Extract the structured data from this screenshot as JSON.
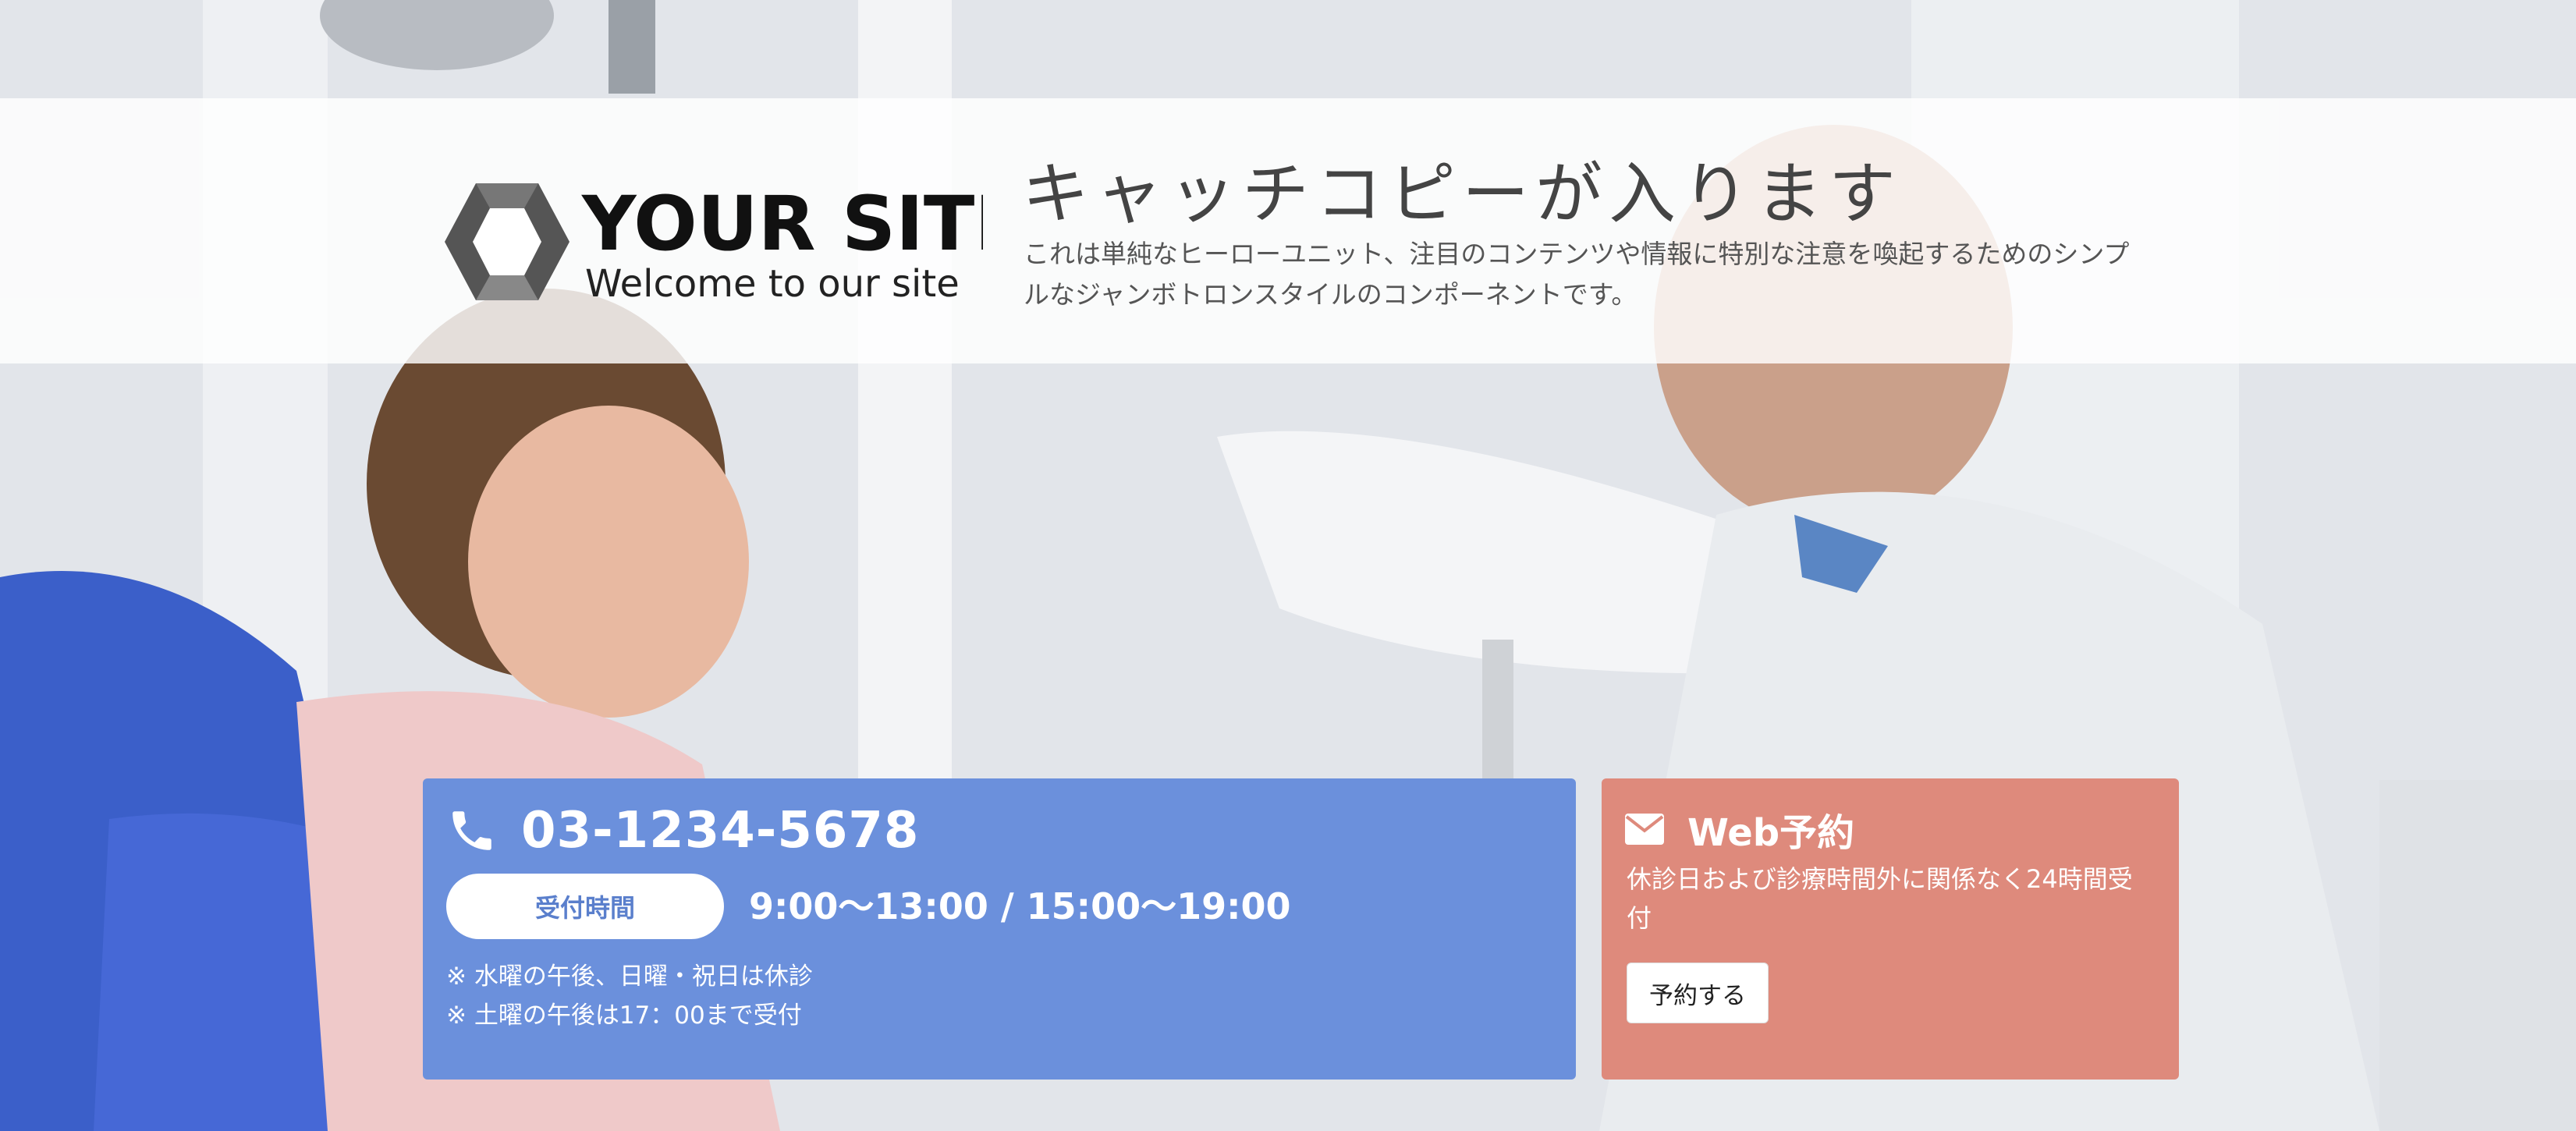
{
  "logo": {
    "title": "YOUR SITE",
    "tagline": "Welcome to our site"
  },
  "hero": {
    "catch_title": "キャッチコピーが入ります",
    "description": "これは単純なヒーローユニット、注目のコンテンツや情報に特別な注意を喚起するためのシンプルなジャンボトロンスタイルのコンポーネントです。"
  },
  "contact": {
    "phone_icon": "phone-icon",
    "phone": "03-1234-5678",
    "hours_label": "受付時間",
    "hours": "9:00〜13:00 / 15:00〜19:00",
    "notes": [
      "※ 水曜の午後、日曜・祝日は休診",
      "※ 土曜の午後は17：00まで受付"
    ],
    "color": "#6b90dc"
  },
  "web_reservation": {
    "mail_icon": "envelope-icon",
    "title": "Web予約",
    "description": "休診日および診療時間外に関係なく24時間受付",
    "button": "予約する",
    "color": "#de8a7c"
  }
}
